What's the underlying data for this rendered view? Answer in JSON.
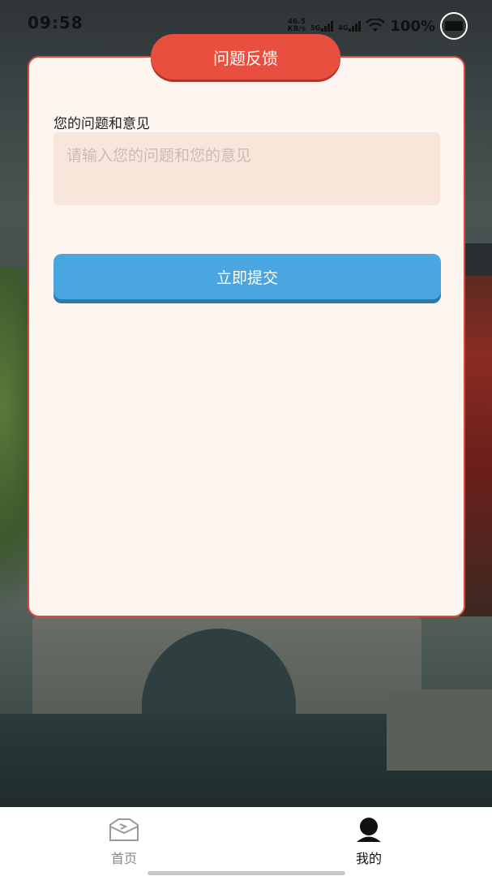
{
  "status_bar": {
    "time": "09:58",
    "speed_value": "46.5",
    "speed_unit": "KB/s",
    "net1": "5G",
    "net2": "4G",
    "battery": "100%"
  },
  "card": {
    "title": "问题反馈",
    "field_label": "您的问题和意见",
    "field_placeholder": "请输入您的问题和您的意见",
    "field_value": "",
    "submit_label": "立即提交"
  },
  "nav": {
    "items": [
      {
        "label": "首页",
        "icon": "home-icon",
        "active": false
      },
      {
        "label": "我的",
        "icon": "user-icon",
        "active": true
      }
    ]
  },
  "colors": {
    "accent_red": "#e84f3e",
    "button_blue": "#4aa6e0",
    "card_bg": "#fdf5f0",
    "input_bg": "#f8e6db"
  }
}
